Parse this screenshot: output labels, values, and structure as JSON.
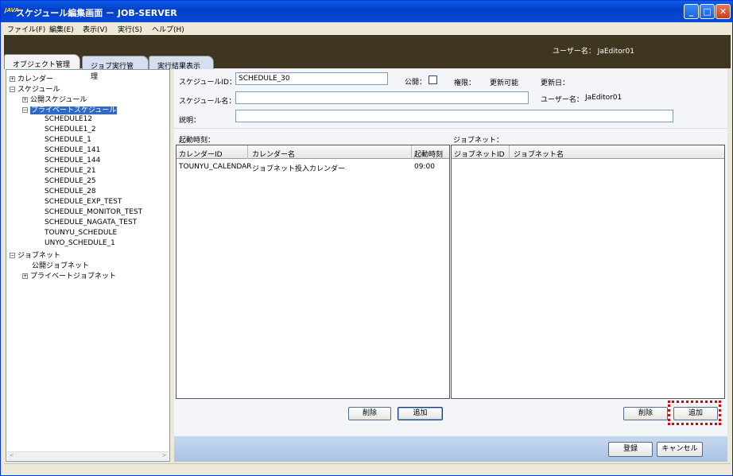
{
  "window": {
    "app_icon": "JAVA",
    "title": "スケジュール編集画面 － JOB-SERVER",
    "controls": [
      "minimize-icon",
      "maximize-icon",
      "close-icon"
    ]
  },
  "menu": [
    "ファイル(F)",
    "編集(E)",
    "表示(V)",
    "実行(S)",
    "ヘルプ(H)"
  ],
  "header": {
    "user": "ユーザー名： JaEditor01"
  },
  "tabs": [
    "オブジェクト管理",
    "ジョブ実行管理",
    "実行結果表示"
  ],
  "tree": {
    "calendar": "カレンダー",
    "schedule": "スケジュール",
    "public_schedule": "公開スケジュール",
    "private_schedule": "プライベートスケジュール",
    "schedules": [
      "SCHEDULE12",
      "SCHEDULE1_2",
      "SCHEDULE_1",
      "SCHEDULE_141",
      "SCHEDULE_144",
      "SCHEDULE_21",
      "SCHEDULE_25",
      "SCHEDULE_28",
      "SCHEDULE_EXP_TEST",
      "SCHEDULE_MONITOR_TEST",
      "SCHEDULE_NAGATA_TEST",
      "TOUNYU_SCHEDULE",
      "UNYO_SCHEDULE_1"
    ],
    "jobnet": "ジョブネット",
    "public_jobnet": "公開ジョブネット",
    "private_jobnet": "プライベートジョブネット"
  },
  "form": {
    "schedule_id_label": "スケジュールID：",
    "schedule_id_value": "SCHEDULE_30",
    "public_label": "公開：",
    "authority_label": "権限：",
    "authority_value": "更新可能",
    "updated_label": "更新日：",
    "schedule_name_label": "スケジュール名：",
    "schedule_name_value": "",
    "username_label": "ユーザー名：",
    "username_value": "JaEditor01",
    "description_label": "説明：",
    "description_value": ""
  },
  "start_time": {
    "section_label": "起動時刻：",
    "columns": [
      "カレンダーID",
      "カレンダー名",
      "起動時刻"
    ],
    "rows": [
      [
        "TOUNYU_CALENDAR",
        "ジョブネット投入カレンダー",
        "09:00"
      ]
    ]
  },
  "jobnet_section": {
    "section_label": "ジョブネット：",
    "columns": [
      "ジョブネットID",
      "ジョブネット名"
    ]
  },
  "buttons": {
    "delete": "削除",
    "add": "追加",
    "register": "登録",
    "cancel": "キャンセル"
  }
}
